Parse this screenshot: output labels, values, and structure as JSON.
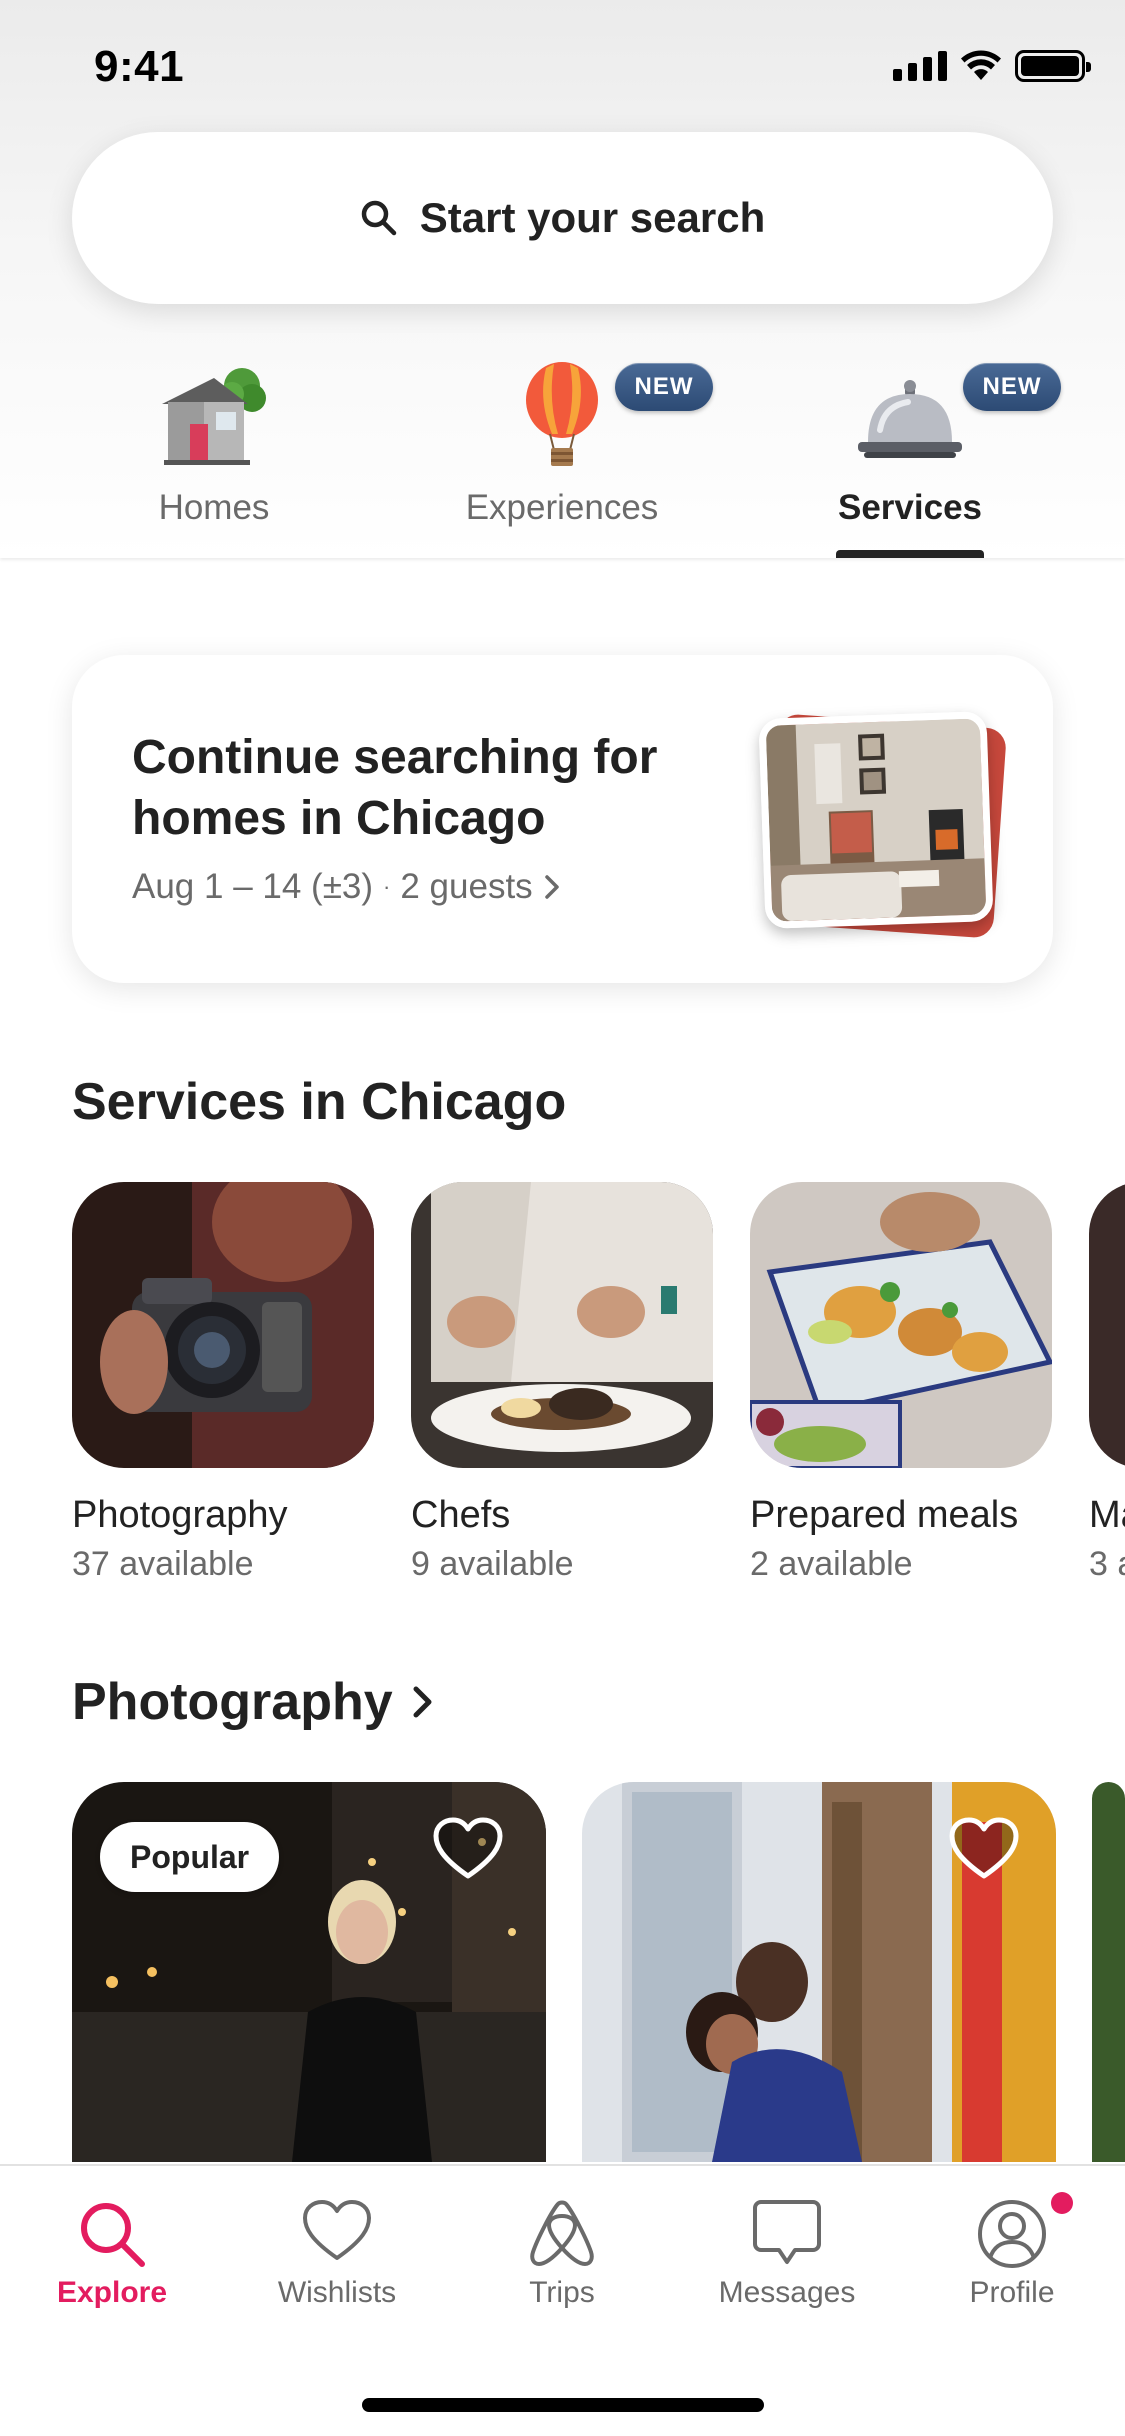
{
  "status_bar": {
    "time": "9:41"
  },
  "search": {
    "label": "Start your search"
  },
  "categories": [
    {
      "label": "Homes",
      "icon": "house-icon",
      "badge": ""
    },
    {
      "label": "Experiences",
      "icon": "hot-air-balloon-icon",
      "badge": "NEW"
    },
    {
      "label": "Services",
      "icon": "service-bell-icon",
      "badge": "NEW",
      "active": true
    }
  ],
  "continue_card": {
    "title": "Continue searching for homes in Chicago",
    "dates": "Aug 1 – 14 (±3)",
    "separator": "·",
    "guests": "2 guests"
  },
  "services_section": {
    "title": "Services in Chicago",
    "items": [
      {
        "name": "Photography",
        "count": "37 available"
      },
      {
        "name": "Chefs",
        "count": "9 available"
      },
      {
        "name": "Prepared meals",
        "count": "2 available"
      },
      {
        "name": "Ma",
        "count": "3 a"
      }
    ]
  },
  "photography_section": {
    "title": "Photography",
    "cards": [
      {
        "badge": "Popular"
      },
      {
        "badge": ""
      }
    ]
  },
  "bottom_nav": {
    "items": [
      {
        "label": "Explore",
        "icon": "search-icon",
        "active": true
      },
      {
        "label": "Wishlists",
        "icon": "heart-icon"
      },
      {
        "label": "Trips",
        "icon": "airbnb-logo-icon"
      },
      {
        "label": "Messages",
        "icon": "message-icon"
      },
      {
        "label": "Profile",
        "icon": "profile-icon",
        "notification": true
      }
    ]
  },
  "colors": {
    "accent": "#e31c5f",
    "text": "#222222",
    "muted": "#6a6a6a",
    "badge": "#2c4a74"
  }
}
